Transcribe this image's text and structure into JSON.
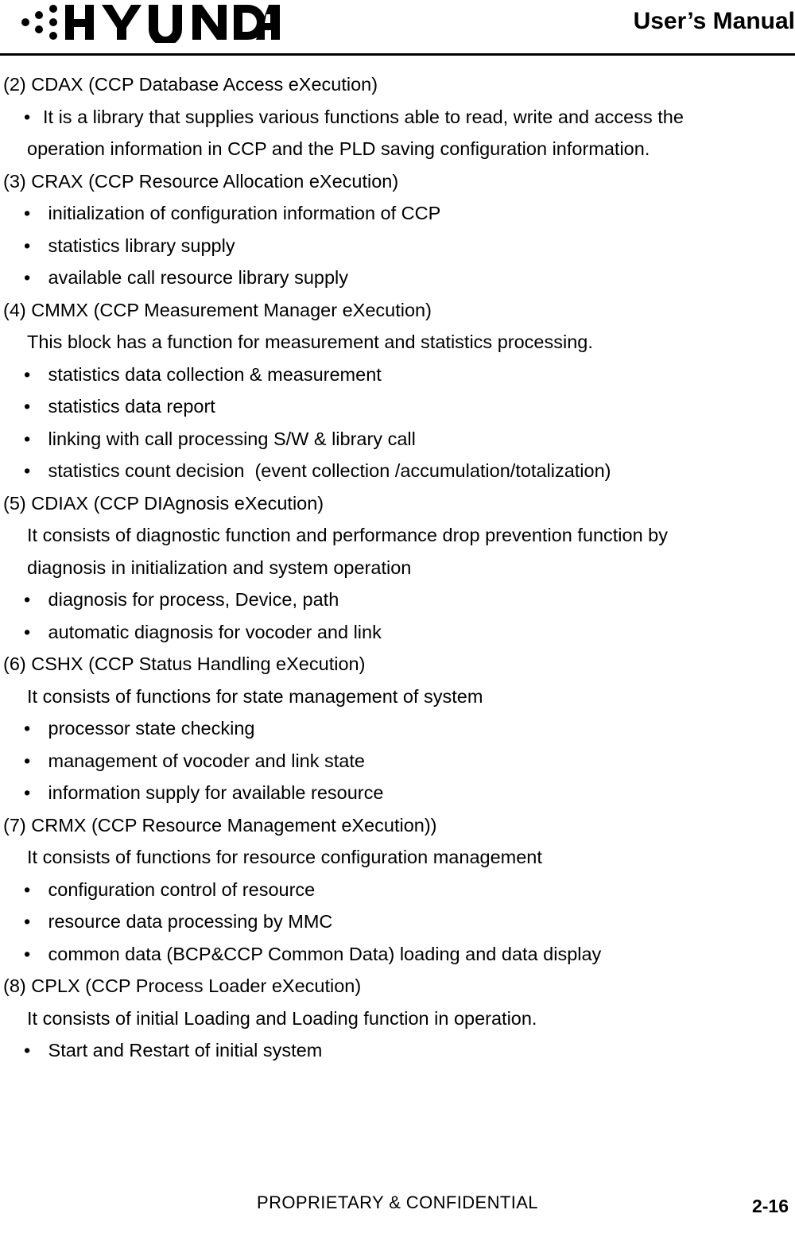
{
  "header": {
    "logo_alt": "HYUNDAI",
    "logo_text": "HYUNDAI",
    "title": "User’s Manual"
  },
  "footer": {
    "confidential": "PROPRIETARY & CONFIDENTIAL",
    "page_number": "2-16"
  },
  "body": {
    "blocks": [
      {
        "heading": "(2) CDAX (CCP Database Access eXecution)",
        "lines": [
          {
            "type": "bullet",
            "text": "It is a library that supplies various functions able to read, write and access the"
          },
          {
            "type": "cont",
            "text": "operation information in CCP and the PLD saving configuration information."
          }
        ]
      },
      {
        "heading": "(3) CRAX (CCP Resource Allocation eXecution)",
        "lines": [
          {
            "type": "bullet",
            "text": " initialization of configuration information of CCP"
          },
          {
            "type": "bullet",
            "text": " statistics library supply"
          },
          {
            "type": "bullet",
            "text": " available call resource library supply"
          }
        ]
      },
      {
        "heading": "(4) CMMX (CCP Measurement Manager eXecution)",
        "lines": [
          {
            "type": "text",
            "text": "This block has a function for measurement and statistics processing."
          },
          {
            "type": "bullet",
            "text": " statistics data collection & measurement"
          },
          {
            "type": "bullet",
            "text": " statistics data report"
          },
          {
            "type": "bullet",
            "text": " linking with call processing S/W & library call"
          },
          {
            "type": "bullet",
            "text": " statistics count decision  (event collection /accumulation/totalization)"
          }
        ]
      },
      {
        "heading": "(5) CDIAX (CCP DIAgnosis eXecution)",
        "lines": [
          {
            "type": "text",
            "text": "It consists of diagnostic function and performance drop prevention function by"
          },
          {
            "type": "text",
            "text": "diagnosis in initialization and system operation"
          },
          {
            "type": "bullet",
            "text": " diagnosis for process, Device, path"
          },
          {
            "type": "bullet",
            "text": " automatic diagnosis for vocoder and link"
          }
        ]
      },
      {
        "heading": "(6) CSHX (CCP Status Handling eXecution)",
        "lines": [
          {
            "type": "text",
            "text": "It consists of functions for state management of system"
          },
          {
            "type": "bullet",
            "text": " processor state checking"
          },
          {
            "type": "bullet",
            "text": " management of vocoder and link state"
          },
          {
            "type": "bullet",
            "text": " information supply for available resource"
          }
        ]
      },
      {
        "heading": "(7) CRMX (CCP Resource Management eXecution))",
        "lines": [
          {
            "type": "text",
            "text": "It consists of functions for resource configuration management"
          },
          {
            "type": "bullet",
            "text": " configuration control of resource"
          },
          {
            "type": "bullet",
            "text": " resource data processing by MMC"
          },
          {
            "type": "bullet",
            "text": " common data (BCP&CCP Common Data) loading and data display"
          }
        ]
      },
      {
        "heading": "(8) CPLX (CCP Process Loader eXecution)",
        "lines": [
          {
            "type": "text",
            "text": "It consists of initial Loading and Loading function in operation."
          },
          {
            "type": "bullet",
            "text": " Start and Restart of initial system"
          }
        ]
      }
    ],
    "bullet_glyph": "•"
  }
}
